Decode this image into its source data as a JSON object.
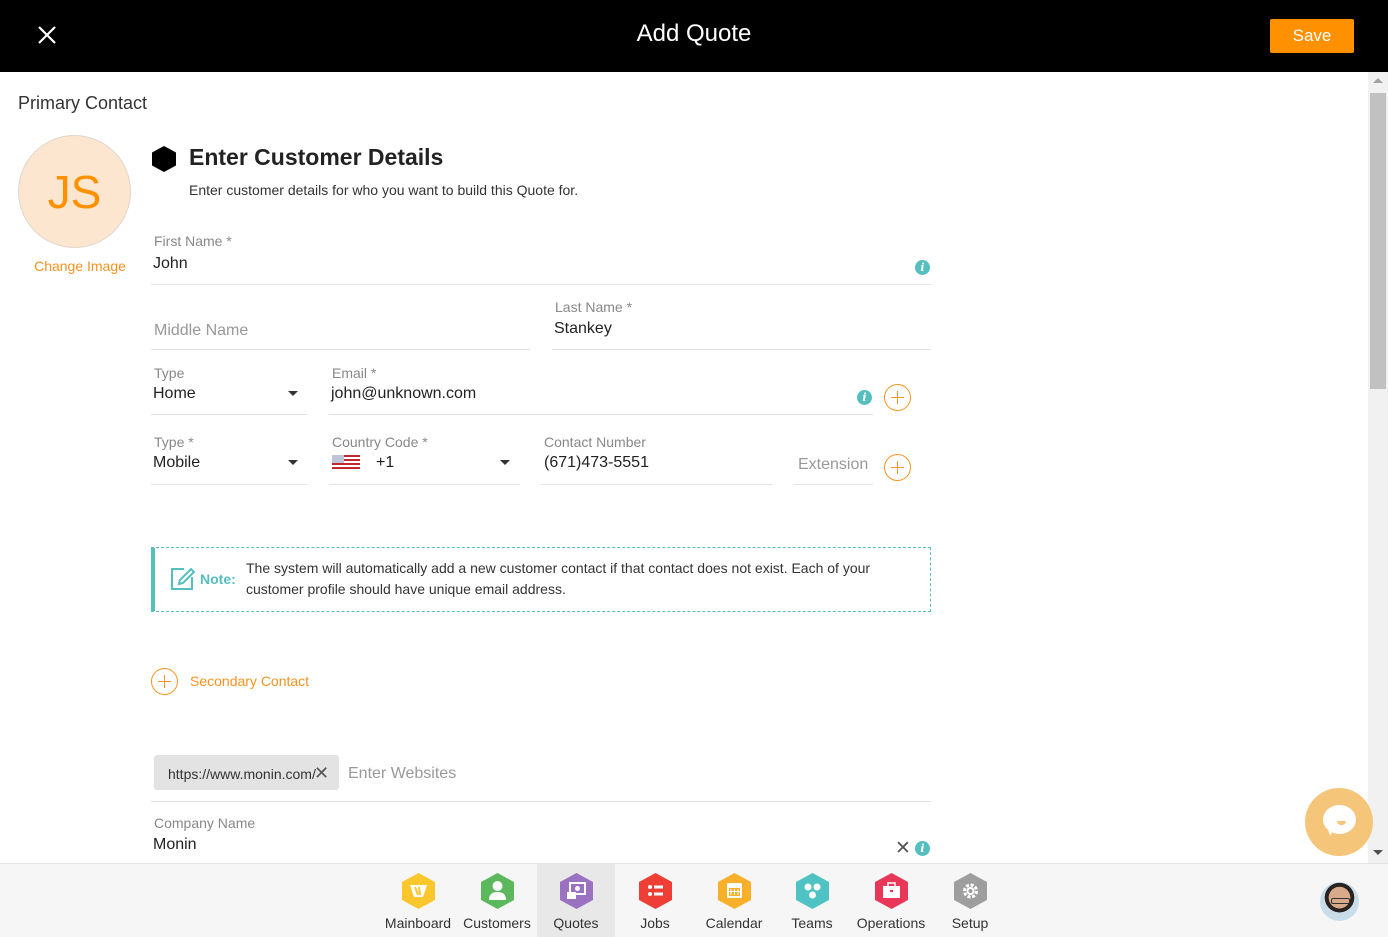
{
  "header": {
    "title": "Add Quote",
    "save_label": "Save",
    "close_icon": "close-icon"
  },
  "colors": {
    "accent": "#ff9100",
    "teal": "#55bfc0",
    "topbar": "#000000"
  },
  "primary_contact": {
    "section_title": "Primary Contact",
    "avatar_initials": "JS",
    "change_image_label": "Change Image",
    "heading": "Enter Customer Details",
    "subheading": "Enter customer details for who you want to build this Quote for.",
    "first_name": {
      "label": "First Name *",
      "value": "John"
    },
    "middle_name": {
      "placeholder": "Middle Name",
      "value": ""
    },
    "last_name": {
      "label": "Last Name *",
      "value": "Stankey"
    },
    "email_type": {
      "label": "Type",
      "value": "Home"
    },
    "email": {
      "label": "Email *",
      "value": "john@unknown.com"
    },
    "phone_type": {
      "label": "Type *",
      "value": "Mobile"
    },
    "country_code": {
      "label": "Country Code *",
      "value": "+1",
      "flag": "us-flag-icon"
    },
    "contact_number": {
      "label": "Contact Number",
      "value": "(671)473-5551"
    },
    "extension": {
      "placeholder": "Extension",
      "value": ""
    }
  },
  "note": {
    "label": "Note:",
    "text": "The system will automatically add a new customer contact if that contact does not exist. Each of your customer profile should have unique email address."
  },
  "secondary_contact": {
    "label": "Secondary Contact"
  },
  "websites": {
    "chips": [
      "https://www.monin.com/"
    ],
    "placeholder": "Enter Websites"
  },
  "company": {
    "label": "Company Name",
    "value": "Monin"
  },
  "bottom_nav": {
    "items": [
      {
        "label": "Mainboard",
        "icon": "mainboard-icon",
        "color": "#fcc72c",
        "active": false
      },
      {
        "label": "Customers",
        "icon": "customers-icon",
        "color": "#5cb85c",
        "active": false
      },
      {
        "label": "Quotes",
        "icon": "quotes-icon",
        "color": "#9b72c2",
        "active": true
      },
      {
        "label": "Jobs",
        "icon": "jobs-icon",
        "color": "#ee3e36",
        "active": false
      },
      {
        "label": "Calendar",
        "icon": "calendar-icon",
        "color": "#f8b02a",
        "active": false
      },
      {
        "label": "Teams",
        "icon": "teams-icon",
        "color": "#4fc3c3",
        "active": false
      },
      {
        "label": "Operations",
        "icon": "operations-icon",
        "color": "#e9375a",
        "active": false
      },
      {
        "label": "Setup",
        "icon": "setup-icon",
        "color": "#9e9e9e",
        "active": false
      }
    ]
  }
}
